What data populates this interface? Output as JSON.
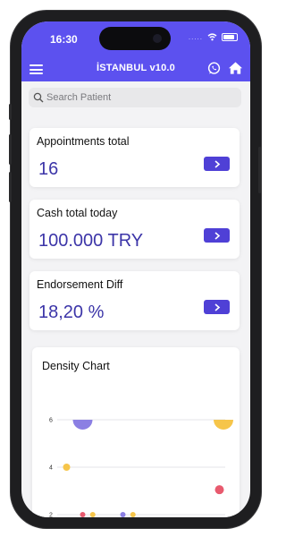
{
  "status_bar": {
    "time": "16:30",
    "signal": "....."
  },
  "header": {
    "title": "İSTANBUL v10.0"
  },
  "search": {
    "placeholder": "Search Patient"
  },
  "cards": [
    {
      "title": "Appointments total",
      "value": "16"
    },
    {
      "title": "Cash total today",
      "value": "100.000 TRY"
    },
    {
      "title": "Endorsement Diff",
      "value": "18,20 %"
    }
  ],
  "colors": {
    "header": "#5c51ef",
    "value_text": "#3c35a8",
    "button": "#4f40d6"
  },
  "chart_data": {
    "type": "scatter",
    "title": "Density Chart",
    "y_ticks": [
      "6",
      "4",
      "2"
    ],
    "ylim": [
      2,
      6
    ],
    "series": [
      {
        "color": "#8b7fe3",
        "points": [
          {
            "x": 1,
            "y": 6,
            "r": 11
          },
          {
            "x": 3,
            "y": 2,
            "r": 3
          }
        ]
      },
      {
        "color": "#f6c54a",
        "points": [
          {
            "x": 8,
            "y": 6,
            "r": 11
          },
          {
            "x": 0.2,
            "y": 4,
            "r": 4
          },
          {
            "x": 1.5,
            "y": 2,
            "r": 3
          },
          {
            "x": 3.5,
            "y": 2,
            "r": 3
          }
        ]
      },
      {
        "color": "#e85a6e",
        "points": [
          {
            "x": 1,
            "y": 2,
            "r": 3
          },
          {
            "x": 7.8,
            "y": 3.05,
            "r": 5
          }
        ]
      }
    ]
  }
}
